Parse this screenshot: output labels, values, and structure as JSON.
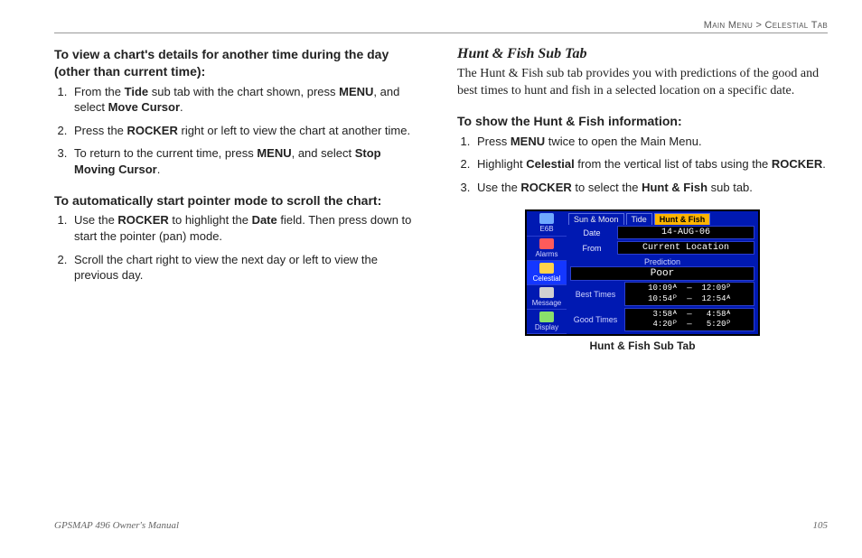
{
  "breadcrumb": {
    "left": "Main Menu",
    "sep": " > ",
    "right": "Celestial Tab"
  },
  "leftCol": {
    "h1": "To view a chart's details for another time during the day (other than current time):",
    "l1": [
      "From the <b>Tide</b> sub tab with the chart shown, press <b>MENU</b>, and select <b>Move Cursor</b>.",
      "Press the <b>ROCKER</b> right or left to view the chart at another time.",
      "To return to the current time, press <b>MENU</b>, and select <b>Stop Moving Cursor</b>."
    ],
    "h2": "To automatically start pointer mode to scroll the chart:",
    "l2": [
      "Use the <b>ROCKER</b> to highlight the <b>Date</b> field. Then press down to start the pointer (pan) mode.",
      "Scroll the chart right to view the next day or left to view the previous day."
    ]
  },
  "rightCol": {
    "title": "Hunt & Fish Sub Tab",
    "body": "The Hunt & Fish sub tab provides you with predictions of the good and best times to hunt and fish in a selected location on a specific date.",
    "h1": "To show the Hunt & Fish information:",
    "l1": [
      "Press <b>MENU</b> twice to open the Main Menu.",
      "Highlight <b>Celestial</b> from the vertical list of tabs using the <b>ROCKER</b>.",
      "Use the <b>ROCKER</b> to select the <b>Hunt & Fish</b> sub tab."
    ],
    "caption": "Hunt & Fish Sub Tab"
  },
  "gps": {
    "side": [
      "E6B",
      "Alarms",
      "Celestial",
      "Message",
      "Display"
    ],
    "tabs": [
      "Sun & Moon",
      "Tide",
      "Hunt & Fish"
    ],
    "date_label": "Date",
    "date": "14-AUG-06",
    "from_label": "From",
    "from": "Current Location",
    "pred_label": "Prediction",
    "pred": "Poor",
    "best_label": "Best Times",
    "best": "10:09ᴬ  —  12:09ᴾ\n10:54ᴾ  —  12:54ᴬ",
    "good_label": "Good Times",
    "good": " 3:58ᴬ  —   4:58ᴬ\n 4:20ᴾ  —   5:20ᴾ"
  },
  "footer": {
    "left": "GPSMAP 496 Owner's Manual",
    "right": "105"
  }
}
